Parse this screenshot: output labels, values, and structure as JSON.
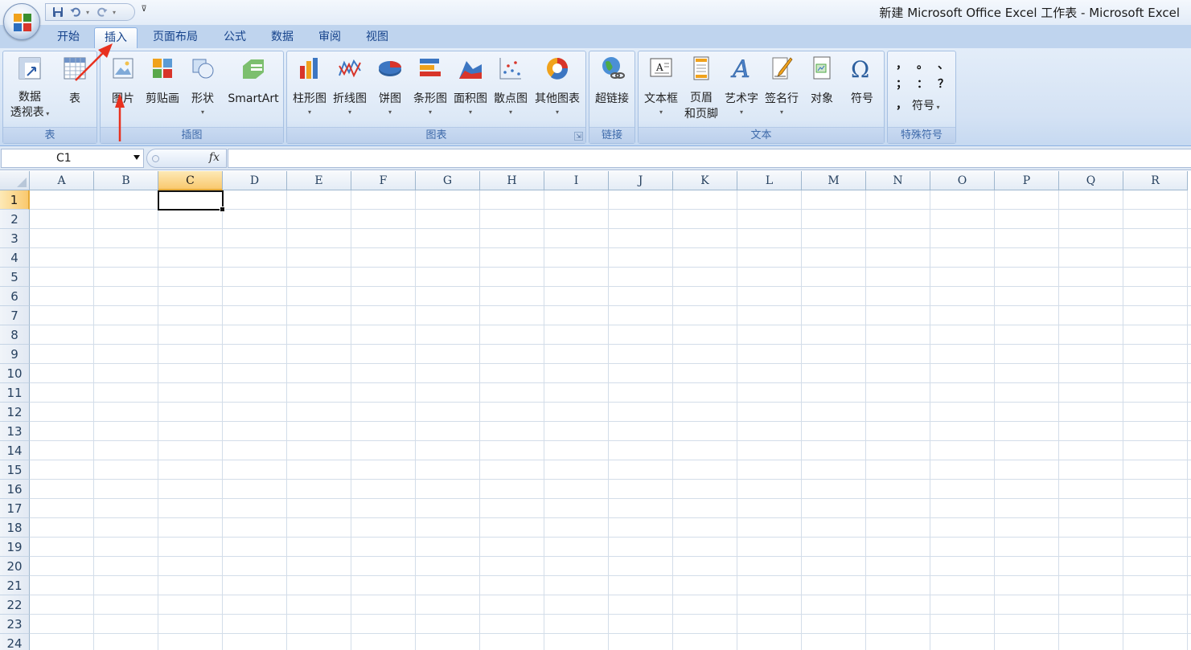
{
  "window": {
    "title": "新建 Microsoft Office Excel 工作表 - Microsoft Excel"
  },
  "quick_access": {
    "icons": [
      "save-icon",
      "undo-icon",
      "redo-icon",
      "customize-qat-icon"
    ],
    "customize_glyph": "⊽"
  },
  "tabs": [
    {
      "label": "开始"
    },
    {
      "label": "插入",
      "active": true
    },
    {
      "label": "页面布局"
    },
    {
      "label": "公式"
    },
    {
      "label": "数据"
    },
    {
      "label": "审阅"
    },
    {
      "label": "视图"
    }
  ],
  "ribbon": {
    "groups": {
      "table": {
        "label": "表",
        "buttons": [
          {
            "line1": "数据",
            "line2": "透视表"
          },
          {
            "label": "表"
          }
        ]
      },
      "illustrations": {
        "label": "插图",
        "buttons": [
          {
            "label": "图片"
          },
          {
            "label": "剪贴画"
          },
          {
            "label": "形状"
          },
          {
            "label": "SmartArt"
          }
        ]
      },
      "charts": {
        "label": "图表",
        "buttons": [
          {
            "label": "柱形图"
          },
          {
            "label": "折线图"
          },
          {
            "label": "饼图"
          },
          {
            "label": "条形图"
          },
          {
            "label": "面积图"
          },
          {
            "label": "散点图"
          },
          {
            "label": "其他图表"
          }
        ]
      },
      "links": {
        "label": "链接",
        "buttons": [
          {
            "label": "超链接"
          }
        ]
      },
      "text": {
        "label": "文本",
        "buttons": [
          {
            "label": "文本框"
          },
          {
            "line1": "页眉",
            "line2": "和页脚"
          },
          {
            "label": "艺术字"
          },
          {
            "label": "签名行"
          },
          {
            "label": "对象"
          },
          {
            "label": "符号"
          }
        ]
      },
      "special_symbols": {
        "label": "特殊符号",
        "symbols": [
          "，",
          "。",
          "、",
          "；",
          "：",
          "？"
        ],
        "more_label": "符号"
      }
    },
    "dropdown_glyph": "▾",
    "launcher_glyph": "⇲"
  },
  "formula_bar": {
    "name_box": "C1",
    "fx": "fx",
    "formula": ""
  },
  "sheet": {
    "columns": [
      "A",
      "B",
      "C",
      "D",
      "E",
      "F",
      "G",
      "H",
      "I",
      "J",
      "K",
      "L",
      "M",
      "N",
      "O",
      "P",
      "Q",
      "R"
    ],
    "rows": [
      "1",
      "2",
      "3",
      "4",
      "5",
      "6",
      "7",
      "8",
      "9",
      "10",
      "11",
      "12",
      "13",
      "14",
      "15",
      "16",
      "17",
      "18",
      "19",
      "20",
      "21",
      "22",
      "23",
      "24"
    ],
    "active_cell": "C1",
    "selected_column": "C",
    "selected_row": "1"
  },
  "colors": {
    "ribbon_text": "#15428b",
    "selection_header": "#f9c96e",
    "annotation_arrow": "#e8311f"
  }
}
